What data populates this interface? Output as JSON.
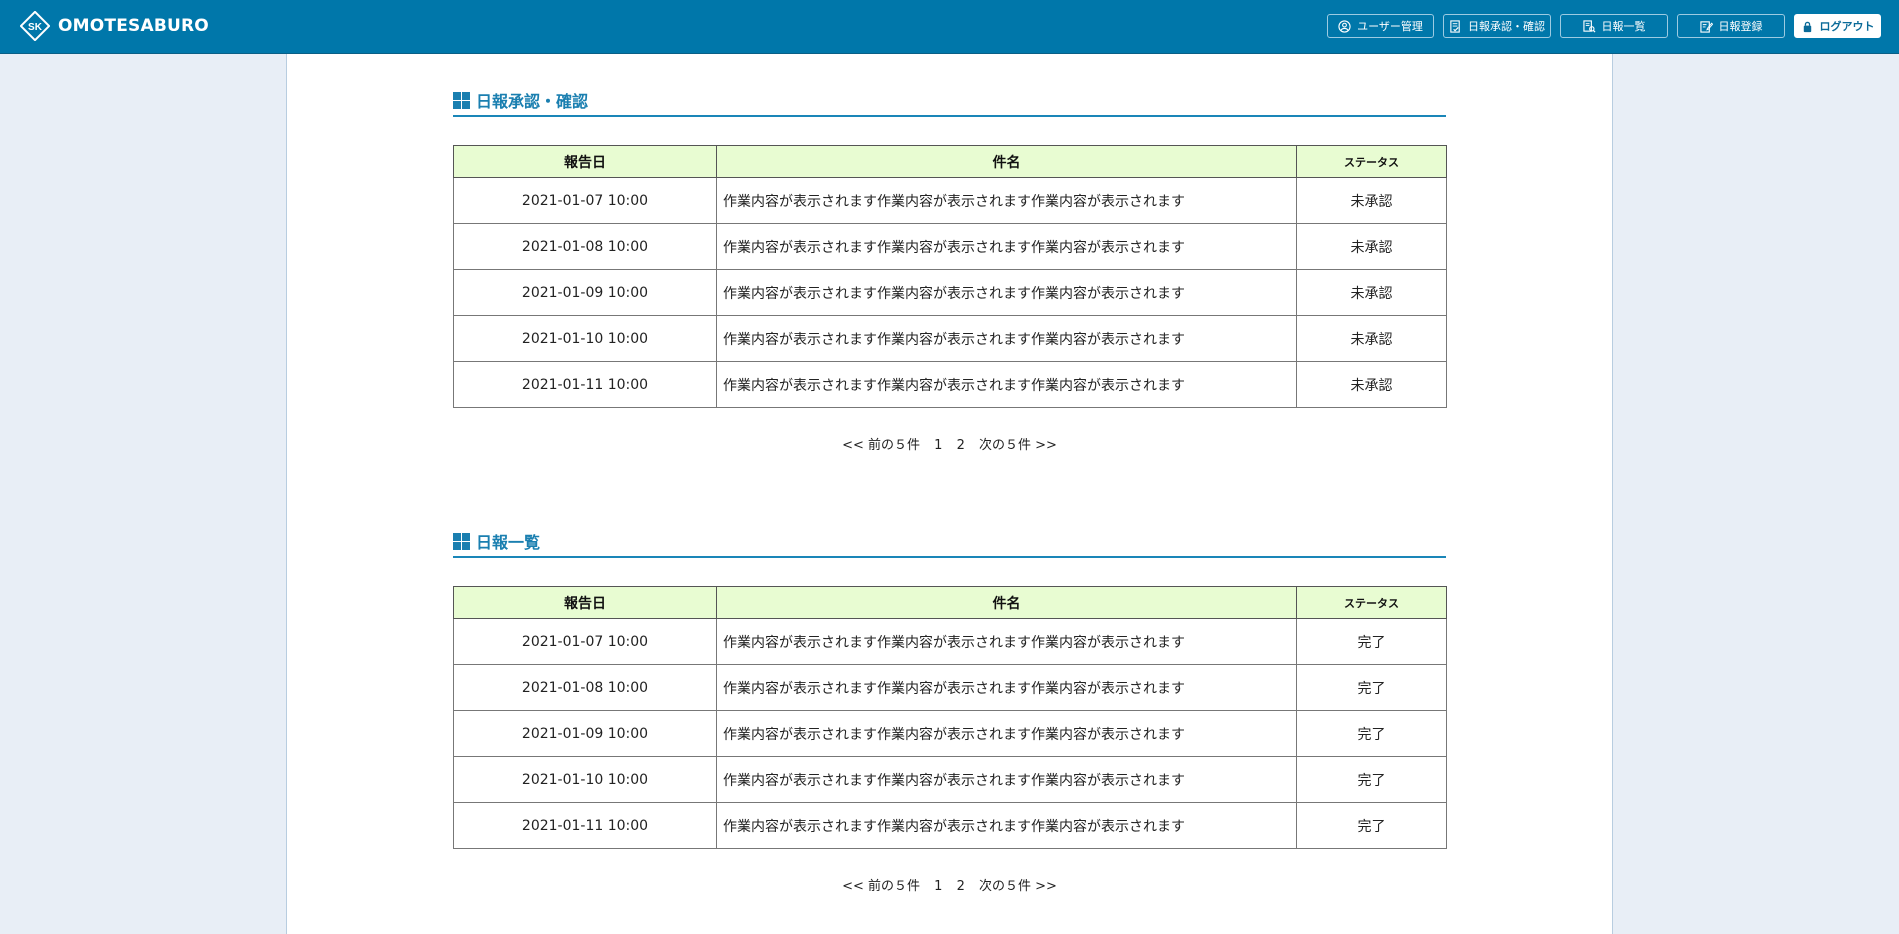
{
  "header": {
    "brand": "OMOTESABURO",
    "nav": {
      "user_mgmt": "ユーザー管理",
      "approve": "日報承認・確認",
      "list": "日報一覧",
      "register": "日報登録",
      "logout": "ログアウト"
    }
  },
  "sections": [
    {
      "title": "日報承認・確認",
      "columns": [
        "報告日",
        "件名",
        "ステータス"
      ],
      "rows": [
        {
          "date": "2021-01-07 10:00",
          "subject": "作業内容が表示されます作業内容が表示されます作業内容が表示されます",
          "status": "未承認"
        },
        {
          "date": "2021-01-08 10:00",
          "subject": "作業内容が表示されます作業内容が表示されます作業内容が表示されます",
          "status": "未承認"
        },
        {
          "date": "2021-01-09 10:00",
          "subject": "作業内容が表示されます作業内容が表示されます作業内容が表示されます",
          "status": "未承認"
        },
        {
          "date": "2021-01-10 10:00",
          "subject": "作業内容が表示されます作業内容が表示されます作業内容が表示されます",
          "status": "未承認"
        },
        {
          "date": "2021-01-11 10:00",
          "subject": "作業内容が表示されます作業内容が表示されます作業内容が表示されます",
          "status": "未承認"
        }
      ],
      "pager": {
        "prev": "<< 前の５件",
        "pages": [
          "1",
          "2"
        ],
        "next": "次の５件 >>"
      }
    },
    {
      "title": "日報一覧",
      "columns": [
        "報告日",
        "件名",
        "ステータス"
      ],
      "rows": [
        {
          "date": "2021-01-07 10:00",
          "subject": "作業内容が表示されます作業内容が表示されます作業内容が表示されます",
          "status": "完了"
        },
        {
          "date": "2021-01-08 10:00",
          "subject": "作業内容が表示されます作業内容が表示されます作業内容が表示されます",
          "status": "完了"
        },
        {
          "date": "2021-01-09 10:00",
          "subject": "作業内容が表示されます作業内容が表示されます作業内容が表示されます",
          "status": "完了"
        },
        {
          "date": "2021-01-10 10:00",
          "subject": "作業内容が表示されます作業内容が表示されます作業内容が表示されます",
          "status": "完了"
        },
        {
          "date": "2021-01-11 10:00",
          "subject": "作業内容が表示されます作業内容が表示されます作業内容が表示されます",
          "status": "完了"
        }
      ],
      "pager": {
        "prev": "<< 前の５件",
        "pages": [
          "1",
          "2"
        ],
        "next": "次の５件 >>"
      }
    }
  ],
  "colors": {
    "header_bg": "#0077aa",
    "accent": "#1a7fb0",
    "table_header_bg": "#e8fcd2",
    "page_bg": "#e8eef6"
  }
}
